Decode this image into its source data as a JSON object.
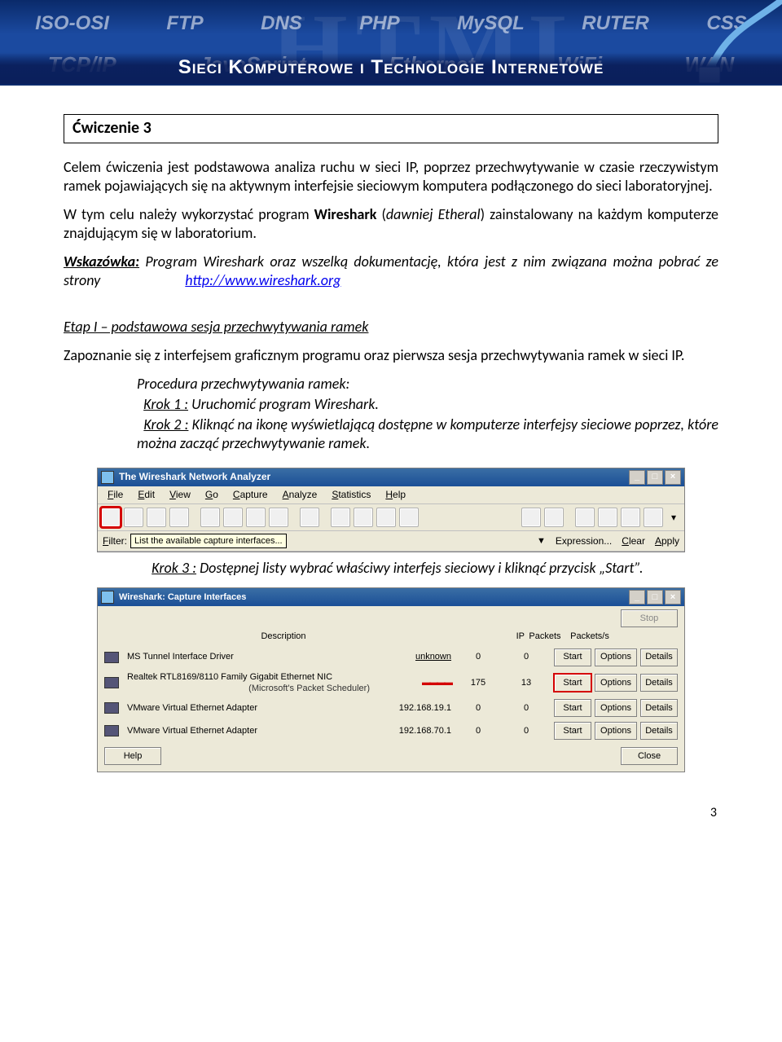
{
  "banner": {
    "row1": [
      "ISO-OSI",
      "FTP",
      "DNS",
      "PHP",
      "MySQL",
      "RUTER",
      "CSS"
    ],
    "row2": [
      "TCP/IP",
      "JavaScript",
      "Ethernet",
      "WiFi",
      "WAN"
    ],
    "bigbg": "HTML",
    "title": "Sieci Komputerowe i Technologie Internetowe"
  },
  "header_box": "Ćwiczenie 3",
  "p1": "Celem ćwiczenia jest podstawowa analiza ruchu w sieci IP, poprzez przechwytywanie w czasie rzeczywistym ramek pojawiających się na aktywnym interfejsie sieciowym komputera podłączonego do sieci laboratoryjnej.",
  "p2_a": "W tym celu należy wykorzystać program ",
  "p2_b": "Wireshark",
  "p2_c": " (",
  "p2_d": "dawniej Etheral",
  "p2_e": ") zainstalowany na każdym komputerze znajdującym się w laboratorium.",
  "hint_label": "Wskazówka:",
  "hint_text_a": " Program Wireshark oraz wszelką dokumentację, która jest z nim związana można pobrać ze strony ",
  "hint_link": "http://www.wireshark.org",
  "etap1": "Etap I – podstawowa sesja przechwytywania ramek",
  "etap1_p": "Zapoznanie się z interfejsem graficznym programu oraz pierwsza sesja przechwytywania ramek w sieci IP.",
  "proc_title": "Procedura przechwytywania ramek:",
  "k1_label": "Krok 1 :",
  "k1_text": " Uruchomić program Wireshark.",
  "k2_label": "Krok 2 :",
  "k2_text": " Kliknąć na ikonę wyświetlającą dostępne w komputerze interfejsy sieciowe poprzez, które można zacząć przechwytywanie ramek.",
  "k3_label": "Krok 3 :",
  "k3_text": " Dostępnej listy wybrać właściwy interfejs sieciowy i kliknąć przycisk „Start”.",
  "ws": {
    "title": "The Wireshark Network Analyzer",
    "menu": [
      "File",
      "Edit",
      "View",
      "Go",
      "Capture",
      "Analyze",
      "Statistics",
      "Help"
    ],
    "filter_label": "Filter:",
    "tooltip": "List the available capture interfaces...",
    "expr": "Expression...",
    "clear": "Clear",
    "apply": "Apply"
  },
  "cap": {
    "title": "Wireshark: Capture Interfaces",
    "cols": {
      "desc": "Description",
      "ip": "IP",
      "pk": "Packets",
      "pks": "Packets/s"
    },
    "stop": "Stop",
    "rows": [
      {
        "desc": "MS Tunnel Interface Driver",
        "sub": "",
        "ip": "unknown",
        "pk": "0",
        "pks": "0",
        "start": "Start",
        "opts": "Options",
        "det": "Details",
        "hl": false
      },
      {
        "desc": "Realtek RTL8169/8110 Family Gigabit Ethernet NIC",
        "sub": "(Microsoft's Packet Scheduler)",
        "ip": "■■■■■",
        "pk": "175",
        "pks": "13",
        "start": "Start",
        "opts": "Options",
        "det": "Details",
        "hl": true
      },
      {
        "desc": "VMware Virtual Ethernet Adapter",
        "sub": "",
        "ip": "192.168.19.1",
        "pk": "0",
        "pks": "0",
        "start": "Start",
        "opts": "Options",
        "det": "Details",
        "hl": false
      },
      {
        "desc": "VMware Virtual Ethernet Adapter",
        "sub": "",
        "ip": "192.168.70.1",
        "pk": "0",
        "pks": "0",
        "start": "Start",
        "opts": "Options",
        "det": "Details",
        "hl": false
      }
    ],
    "help": "Help",
    "close": "Close"
  },
  "page_num": "3"
}
